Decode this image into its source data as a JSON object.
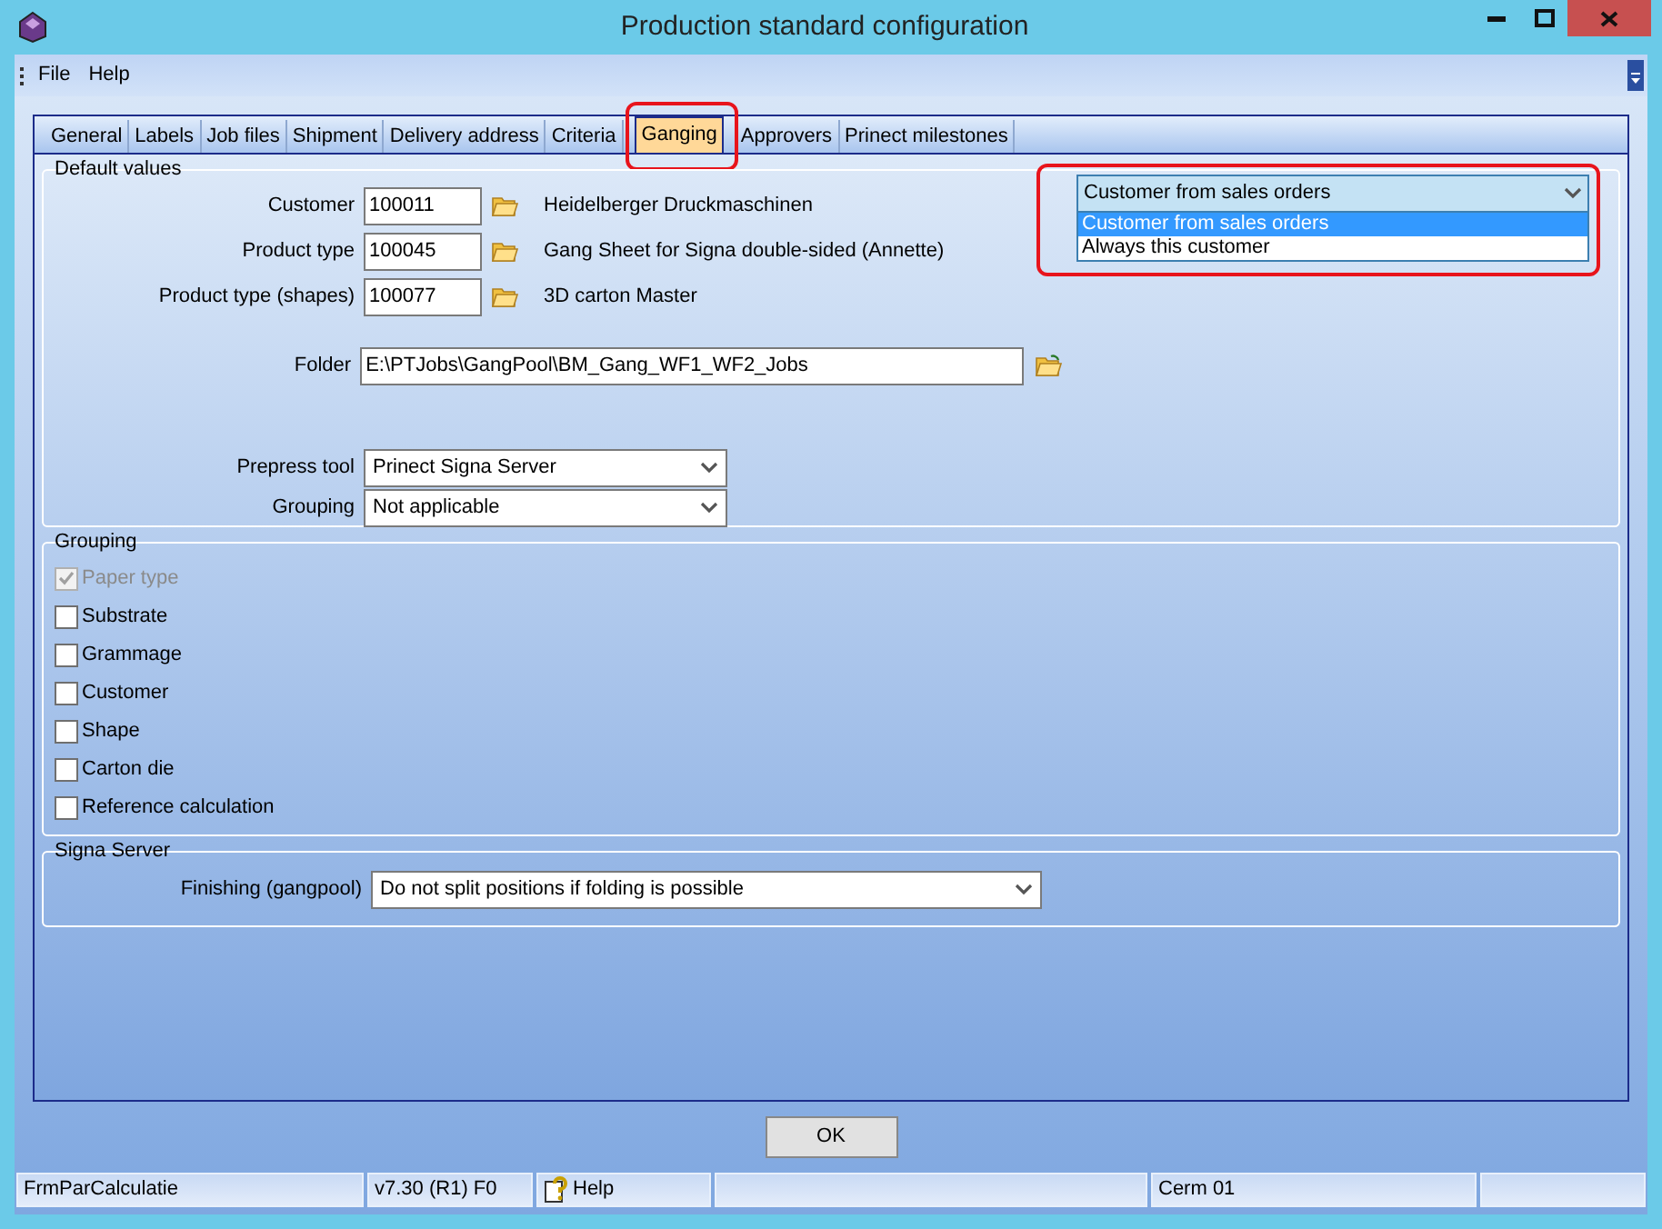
{
  "window": {
    "title": "Production standard configuration"
  },
  "menu": [
    "File",
    "Help"
  ],
  "tabs": [
    {
      "label": "General",
      "selected": false
    },
    {
      "label": "Labels",
      "selected": false
    },
    {
      "label": "Job files",
      "selected": false
    },
    {
      "label": "Shipment",
      "selected": false
    },
    {
      "label": "Delivery address",
      "selected": false
    },
    {
      "label": "Criteria",
      "selected": false
    },
    {
      "label": "Ganging",
      "selected": true
    },
    {
      "label": "Approvers",
      "selected": false
    },
    {
      "label": "Prinect milestones",
      "selected": false
    }
  ],
  "default_values": {
    "title": "Default values",
    "fields": [
      {
        "label": "Customer",
        "code": "100011",
        "description": "Heidelberger Druckmaschinen"
      },
      {
        "label": "Product type",
        "code": "100045",
        "description": "Gang Sheet for Signa double-sided  (Annette)"
      },
      {
        "label": "Product type (shapes)",
        "code": "100077",
        "description": "3D carton Master"
      }
    ],
    "folder": {
      "label": "Folder",
      "value": "E:\\PTJobs\\GangPool\\BM_Gang_WF1_WF2_Jobs"
    },
    "selects": [
      {
        "label": "Prepress tool",
        "value": "Prinect Signa Server"
      },
      {
        "label": "Grouping",
        "value": "Not applicable"
      }
    ],
    "customer_source": {
      "value": "Customer from sales orders",
      "options": [
        {
          "label": "Customer from sales orders",
          "selected": true
        },
        {
          "label": "Always this customer",
          "selected": false
        }
      ]
    }
  },
  "grouping": {
    "title": "Grouping",
    "items": [
      {
        "label": "Paper type",
        "checked": true,
        "disabled": true
      },
      {
        "label": "Substrate",
        "checked": false,
        "disabled": false
      },
      {
        "label": "Grammage",
        "checked": false,
        "disabled": false
      },
      {
        "label": "Customer",
        "checked": false,
        "disabled": false
      },
      {
        "label": "Shape",
        "checked": false,
        "disabled": false
      },
      {
        "label": "Carton die",
        "checked": false,
        "disabled": false
      },
      {
        "label": "Reference calculation",
        "checked": false,
        "disabled": false
      }
    ]
  },
  "signa_server": {
    "title": "Signa Server",
    "finishing": {
      "label": "Finishing (gangpool)",
      "value": "Do not split positions if folding is possible"
    }
  },
  "ok_button": "OK",
  "status_bar": [
    {
      "kind": "text",
      "text": "FrmParCalculatie"
    },
    {
      "kind": "text",
      "text": "v7.30 (R1) F0"
    },
    {
      "kind": "help",
      "text": "Help"
    },
    {
      "kind": "empty"
    },
    {
      "kind": "text",
      "text": "Cerm 01"
    },
    {
      "kind": "empty"
    }
  ]
}
